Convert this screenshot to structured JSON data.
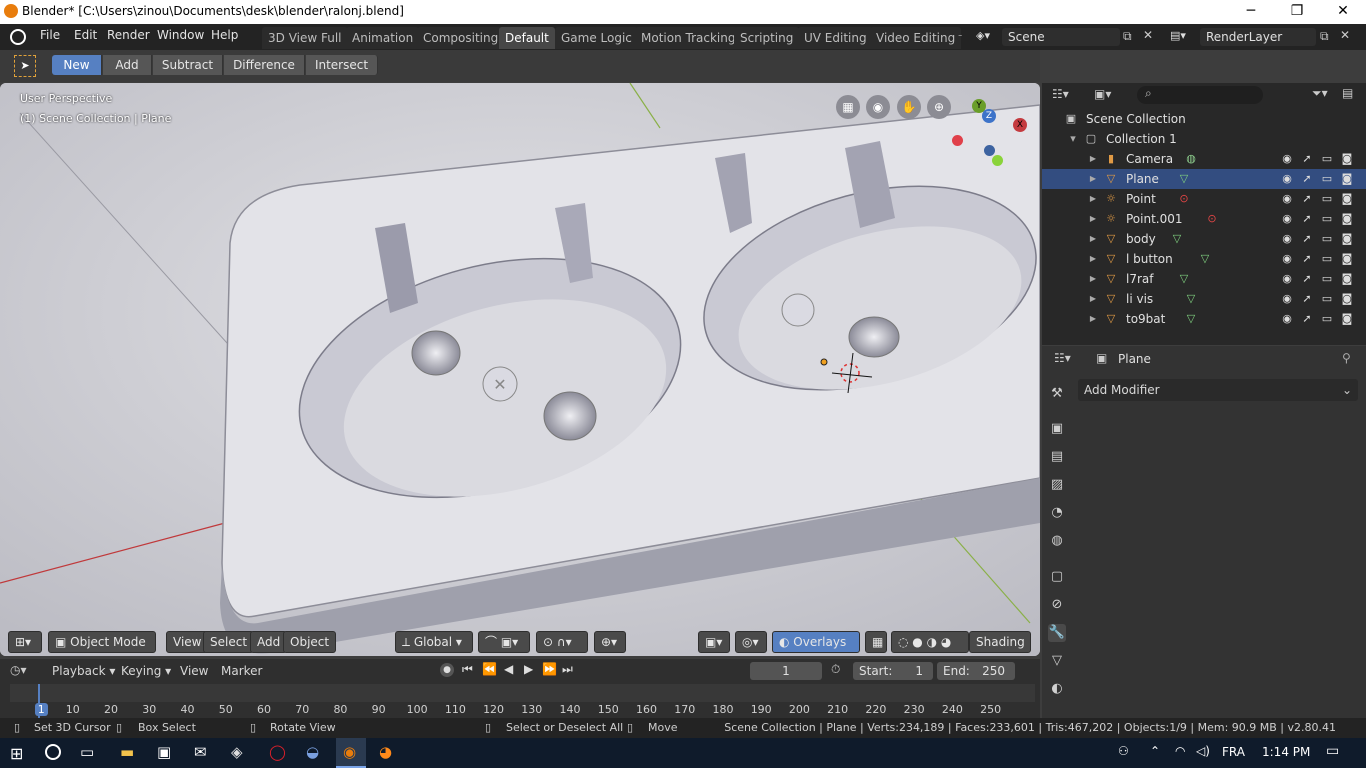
{
  "window": {
    "title": "Blender* [C:\\Users\\zinou\\Documents\\desk\\blender\\ralonj.blend]",
    "minimize": "─",
    "maximize": "❐",
    "close": "✕"
  },
  "menus": [
    "File",
    "Edit",
    "Render",
    "Window",
    "Help"
  ],
  "workspaces": [
    "3D View Full",
    "Animation",
    "Compositing",
    "Default",
    "Game Logic",
    "Motion Tracking",
    "Scripting",
    "UV Editing",
    "Video Editing"
  ],
  "workspaces_more": "-",
  "scene": {
    "name": "Scene",
    "render_layer": "RenderLayer"
  },
  "tool_header": {
    "buttons": [
      "New",
      "Add",
      "Subtract",
      "Difference",
      "Intersect"
    ],
    "selected": "New"
  },
  "viewport": {
    "perspective": "User Perspective",
    "collection_info": "(1) Scene Collection | Plane",
    "header": {
      "mode": "Object Mode",
      "view": "View",
      "select": "Select",
      "add": "Add",
      "object": "Object",
      "orientation": "Global",
      "overlays": "Overlays",
      "shading": "Shading"
    },
    "gizmo": {
      "x": "X",
      "y": "Y",
      "z": "Z"
    }
  },
  "outliner": {
    "root": "Scene Collection",
    "collection": "Collection 1",
    "items": [
      {
        "name": "Camera",
        "type": "camera",
        "icon": "camera-icon"
      },
      {
        "name": "Plane",
        "type": "mesh",
        "icon": "mesh-icon",
        "selected": true
      },
      {
        "name": "Point",
        "type": "light",
        "icon": "light-icon"
      },
      {
        "name": "Point.001",
        "type": "light",
        "icon": "light-icon"
      },
      {
        "name": "body",
        "type": "mesh",
        "icon": "mesh-icon"
      },
      {
        "name": "l button",
        "type": "mesh",
        "icon": "mesh-icon"
      },
      {
        "name": "l7raf",
        "type": "mesh",
        "icon": "mesh-icon"
      },
      {
        "name": "li vis",
        "type": "mesh",
        "icon": "mesh-icon"
      },
      {
        "name": "to9bat",
        "type": "mesh",
        "icon": "mesh-icon"
      }
    ]
  },
  "properties": {
    "object_name": "Plane",
    "add_modifier": "Add Modifier"
  },
  "timeline": {
    "menus": [
      "Playback",
      "Keying",
      "View",
      "Marker"
    ],
    "current_frame": "1",
    "start_label": "Start:",
    "start": "1",
    "end_label": "End:",
    "end": "250",
    "ticks": [
      "1",
      "10",
      "20",
      "30",
      "40",
      "50",
      "60",
      "70",
      "80",
      "90",
      "100",
      "110",
      "120",
      "130",
      "140",
      "150",
      "160",
      "170",
      "180",
      "190",
      "200",
      "210",
      "220",
      "230",
      "240",
      "250"
    ]
  },
  "statusbar": {
    "left": [
      "Set 3D Cursor",
      "Box Select",
      "Rotate View"
    ],
    "middle": [
      "Select or Deselect All",
      "Move"
    ],
    "stats": "Scene Collection | Plane | Verts:234,189 | Faces:233,601 | Tris:467,202 | Objects:1/9 | Mem: 90.9 MB | v2.80.41"
  },
  "taskbar": {
    "language": "FRA",
    "time": "1:14 PM"
  },
  "colors": {
    "accent": "#5680c2",
    "selected_row": "#334d80",
    "header": "#232323"
  }
}
